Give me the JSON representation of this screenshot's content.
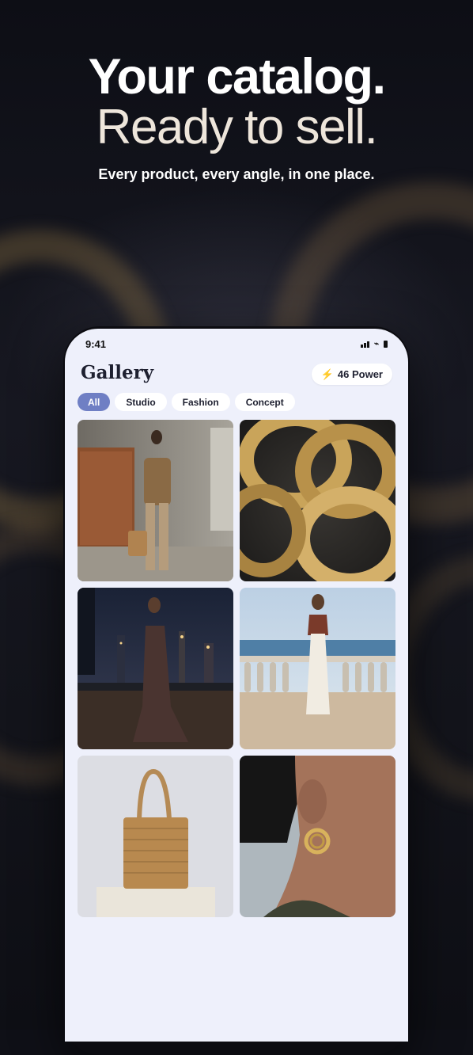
{
  "hero": {
    "line1": "Your catalog.",
    "line2": "Ready to sell.",
    "subtitle": "Every product, every angle, in one place."
  },
  "status_bar": {
    "time": "9:41"
  },
  "app": {
    "title": "Gallery",
    "power_label": "46 Power",
    "power_icon": "lightning-icon",
    "filters": [
      {
        "label": "All",
        "active": true
      },
      {
        "label": "Studio",
        "active": false
      },
      {
        "label": "Fashion",
        "active": false
      },
      {
        "label": "Concept",
        "active": false
      }
    ],
    "gallery": [
      {
        "subject": "model-in-suede-suit"
      },
      {
        "subject": "gold-ring-links"
      },
      {
        "subject": "model-in-slip-dress-city-night"
      },
      {
        "subject": "model-in-white-dress-terrace"
      },
      {
        "subject": "woven-tote-bag"
      },
      {
        "subject": "gold-hoop-earring"
      }
    ]
  },
  "colors": {
    "accent": "#6f7fc4",
    "screen_bg": "#eef0fb",
    "hero_text": "#ffffff",
    "hero_text_secondary": "#eee6db",
    "power_icon": "#f5a623"
  }
}
